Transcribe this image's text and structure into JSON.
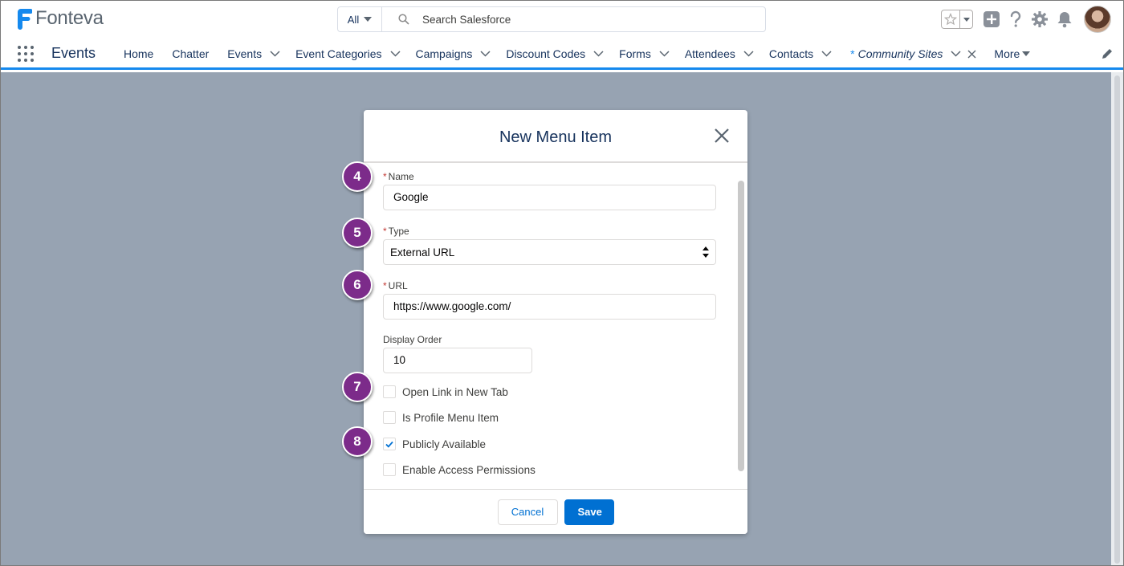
{
  "brand": {
    "name": "Fonteva",
    "logo_color": "#1589ee"
  },
  "search": {
    "scope": "All",
    "placeholder": "Search Salesforce"
  },
  "header_icons": [
    "favorites-star-icon",
    "add-icon",
    "help-icon",
    "setup-gear-icon",
    "notification-bell-icon",
    "user-avatar"
  ],
  "nav": {
    "app_name": "Events",
    "tabs": [
      {
        "label": "Home",
        "dropdown": false
      },
      {
        "label": "Chatter",
        "dropdown": false
      },
      {
        "label": "Events",
        "dropdown": true
      },
      {
        "label": "Event Categories",
        "dropdown": true
      },
      {
        "label": "Campaigns",
        "dropdown": true
      },
      {
        "label": "Discount Codes",
        "dropdown": true
      },
      {
        "label": "Forms",
        "dropdown": true
      },
      {
        "label": "Attendees",
        "dropdown": true
      },
      {
        "label": "Contacts",
        "dropdown": true
      },
      {
        "label": "Community Sites",
        "dropdown": true,
        "active": true,
        "unsaved_marker": "*",
        "closable": true
      }
    ],
    "more_label": "More",
    "accent_color": "#1589ee"
  },
  "modal": {
    "title": "New Menu Item",
    "fields": {
      "name": {
        "label": "Name",
        "required": true,
        "value": "Google"
      },
      "type": {
        "label": "Type",
        "required": true,
        "value": "External URL"
      },
      "url": {
        "label": "URL",
        "required": true,
        "value": "https://www.google.com/"
      },
      "display_order": {
        "label": "Display Order",
        "required": false,
        "value": "10"
      }
    },
    "checkboxes": [
      {
        "label": "Open Link in New Tab",
        "checked": false
      },
      {
        "label": "Is Profile Menu Item",
        "checked": false
      },
      {
        "label": "Publicly Available",
        "checked": true
      },
      {
        "label": "Enable Access Permissions",
        "checked": false
      }
    ],
    "cancel_label": "Cancel",
    "save_label": "Save",
    "brand_color": "#0070d2"
  },
  "step_badges": [
    "4",
    "5",
    "6",
    "7",
    "8"
  ],
  "badge_color": "#7c2b8a"
}
